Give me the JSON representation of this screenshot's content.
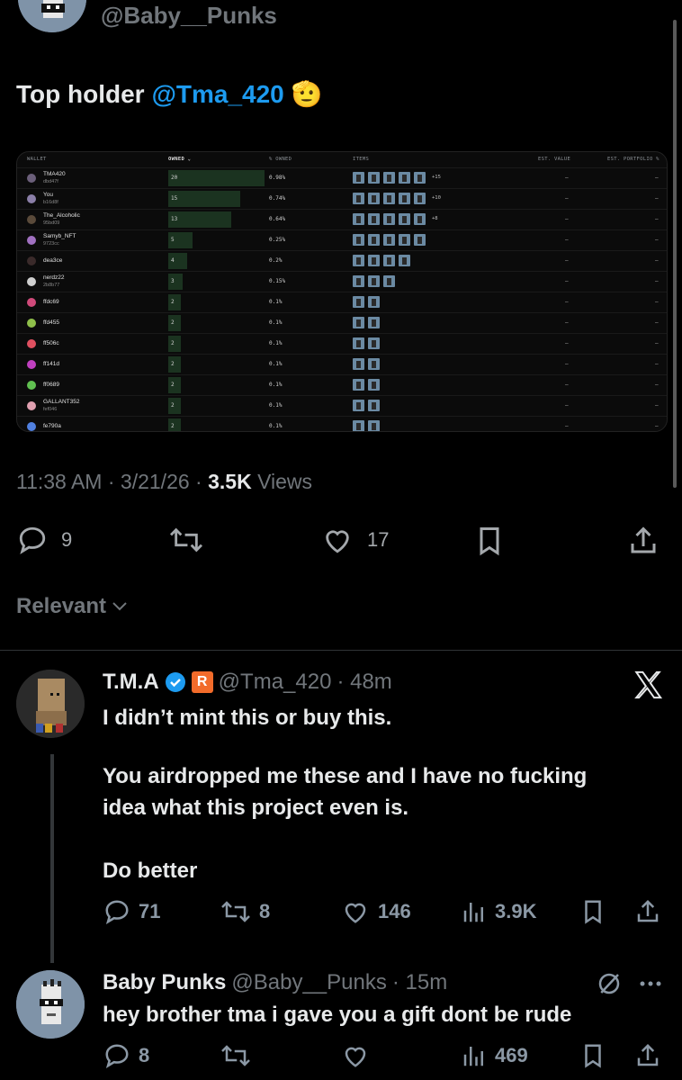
{
  "top": {
    "handle": "@Baby__Punks"
  },
  "tweet": {
    "text": "Top holder ",
    "mention": "@Tma_420",
    "emoji": "🫡"
  },
  "table": {
    "headers": [
      "WALLET",
      "OWNED ⌄",
      "% OWNED",
      "ITEMS",
      "EST. VALUE",
      "EST. PORTFOLIO %"
    ],
    "rows": [
      {
        "name": "TMA420",
        "sub": "dbd47f",
        "owned": "20",
        "pct": "0.98%",
        "items": 5,
        "more": "+15",
        "color": "#6b5f7a"
      },
      {
        "name": "You",
        "sub": "b16d8f",
        "owned": "15",
        "pct": "0.74%",
        "items": 5,
        "more": "+10",
        "color": "#8b7fa8"
      },
      {
        "name": "The_Alcoholic",
        "sub": "95bd09",
        "owned": "13",
        "pct": "0.64%",
        "items": 5,
        "more": "+8",
        "color": "#5a4a3a"
      },
      {
        "name": "Samyb_NFT",
        "sub": "9723cc",
        "owned": "5",
        "pct": "0.25%",
        "items": 5,
        "more": "",
        "color": "#a070c0"
      },
      {
        "name": "dea3ce",
        "sub": "",
        "owned": "4",
        "pct": "0.2%",
        "items": 4,
        "more": "",
        "color": "#3a2a2a"
      },
      {
        "name": "nerdz22",
        "sub": "2b8b77",
        "owned": "3",
        "pct": "0.15%",
        "items": 3,
        "more": "",
        "color": "#cfcfcf"
      },
      {
        "name": "ffdc69",
        "sub": "",
        "owned": "2",
        "pct": "0.1%",
        "items": 2,
        "more": "",
        "color": "#d04a7a"
      },
      {
        "name": "ffd455",
        "sub": "",
        "owned": "2",
        "pct": "0.1%",
        "items": 2,
        "more": "",
        "color": "#8fbf4a"
      },
      {
        "name": "ff506c",
        "sub": "",
        "owned": "2",
        "pct": "0.1%",
        "items": 2,
        "more": "",
        "color": "#e05060"
      },
      {
        "name": "ff141d",
        "sub": "",
        "owned": "2",
        "pct": "0.1%",
        "items": 2,
        "more": "",
        "color": "#c040c0"
      },
      {
        "name": "ff0689",
        "sub": "",
        "owned": "2",
        "pct": "0.1%",
        "items": 2,
        "more": "",
        "color": "#60c050"
      },
      {
        "name": "GALLANT352",
        "sub": "fef046",
        "owned": "2",
        "pct": "0.1%",
        "items": 2,
        "more": "",
        "color": "#e0a0b0"
      },
      {
        "name": "fe790a",
        "sub": "",
        "owned": "2",
        "pct": "0.1%",
        "items": 2,
        "more": "",
        "color": "#5080e0"
      }
    ],
    "dash": "–"
  },
  "meta": {
    "time": "11:38 AM · 3/21/26 · ",
    "views_count": "3.5K",
    "views_label": " Views"
  },
  "actions": {
    "replies": "9",
    "likes": "17"
  },
  "sort": {
    "label": "Relevant"
  },
  "reply1": {
    "name": "T.M.A",
    "handle": "@Tma_420",
    "time": "· 48m",
    "line1": "I didn’t mint this or buy this.",
    "line2": "You airdropped me these and I have no fucking",
    "line3": "idea what this project even is.",
    "line4": "Do better",
    "replies": "71",
    "reposts": "8",
    "likes": "146",
    "views": "3.9K",
    "badge_letter": "R"
  },
  "reply2": {
    "name": "Baby Punks",
    "handle": "@Baby__Punks",
    "time": "· 15m",
    "text": "hey brother tma i gave you a gift dont be rude",
    "replies": "8",
    "views": "469"
  },
  "colors": {
    "accent": "#1d9bf0",
    "muted": "#71767b",
    "background": "#000000"
  }
}
